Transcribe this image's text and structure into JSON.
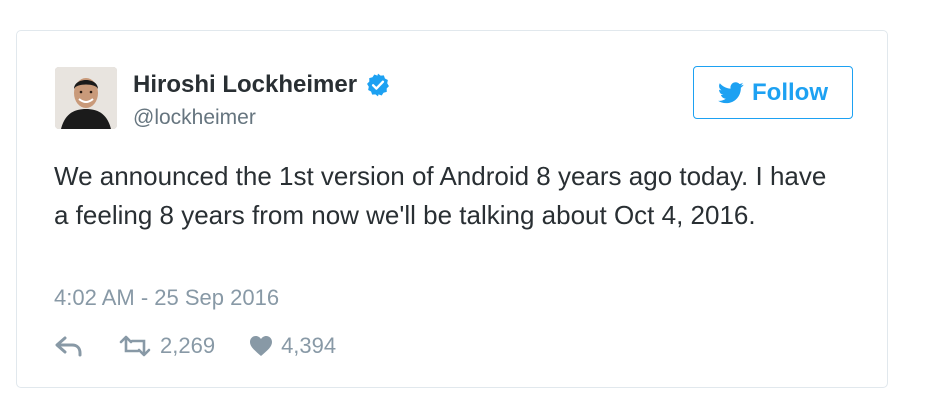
{
  "tweet": {
    "user": {
      "display_name": "Hiroshi Lockheimer",
      "handle": "@lockheimer",
      "verified": true
    },
    "follow_label": "Follow",
    "text": "We announced the 1st version of Android 8 years ago today. I have a feeling 8 years from now we'll be talking about Oct 4, 2016.",
    "timestamp": "4:02 AM - 25 Sep 2016",
    "retweet_count": "2,269",
    "like_count": "4,394"
  },
  "icons": {
    "verified": "verified-badge-icon",
    "follow": "twitter-bird-icon",
    "reply": "reply-icon",
    "retweet": "retweet-icon",
    "like": "heart-icon"
  },
  "colors": {
    "accent": "#1da1f2",
    "text": "#292f33",
    "muted": "#8899a6",
    "border": "#e1e8ed"
  }
}
